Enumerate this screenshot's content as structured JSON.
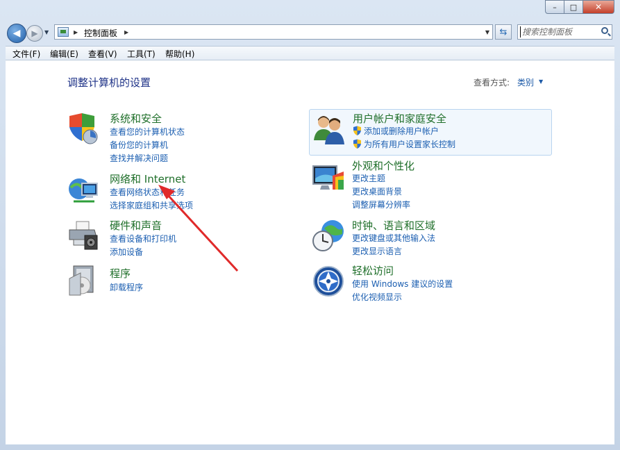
{
  "window": {
    "min_label": "–",
    "max_label": "□",
    "close_label": "✕"
  },
  "address": {
    "breadcrumb": "控制面板",
    "search_placeholder": "搜索控制面板"
  },
  "menu": {
    "file": "文件(F)",
    "edit": "编辑(E)",
    "view": "查看(V)",
    "tools": "工具(T)",
    "help": "帮助(H)"
  },
  "page": {
    "title": "调整计算机的设置",
    "view_by_label": "查看方式:",
    "view_by_value": "类别"
  },
  "categories": {
    "system_security": {
      "title": "系统和安全",
      "icon": "shield-icon",
      "links": [
        "查看您的计算机状态",
        "备份您的计算机",
        "查找并解决问题"
      ]
    },
    "network": {
      "title": "网络和 Internet",
      "icon": "network-icon",
      "links": [
        "查看网络状态和任务",
        "选择家庭组和共享选项"
      ]
    },
    "hardware": {
      "title": "硬件和声音",
      "icon": "printer-icon",
      "links": [
        "查看设备和打印机",
        "添加设备"
      ]
    },
    "programs": {
      "title": "程序",
      "icon": "programs-icon",
      "links": [
        "卸载程序"
      ]
    },
    "user_accounts": {
      "title": "用户帐户和家庭安全",
      "icon": "users-icon",
      "links": [
        "添加或删除用户帐户",
        "为所有用户设置家长控制"
      ]
    },
    "appearance": {
      "title": "外观和个性化",
      "icon": "monitor-icon",
      "links": [
        "更改主题",
        "更改桌面背景",
        "调整屏幕分辨率"
      ]
    },
    "clock": {
      "title": "时钟、语言和区域",
      "icon": "clock-globe-icon",
      "links": [
        "更改键盘或其他输入法",
        "更改显示语言"
      ]
    },
    "ease": {
      "title": "轻松访问",
      "icon": "ease-of-access-icon",
      "links": [
        "使用 Windows 建议的设置",
        "优化视频显示"
      ]
    }
  },
  "colors": {
    "title_green": "#1f6f2a",
    "link_blue": "#1c5fb1",
    "heading_blue": "#1e3287",
    "annotation_red": "#e02a2a"
  }
}
